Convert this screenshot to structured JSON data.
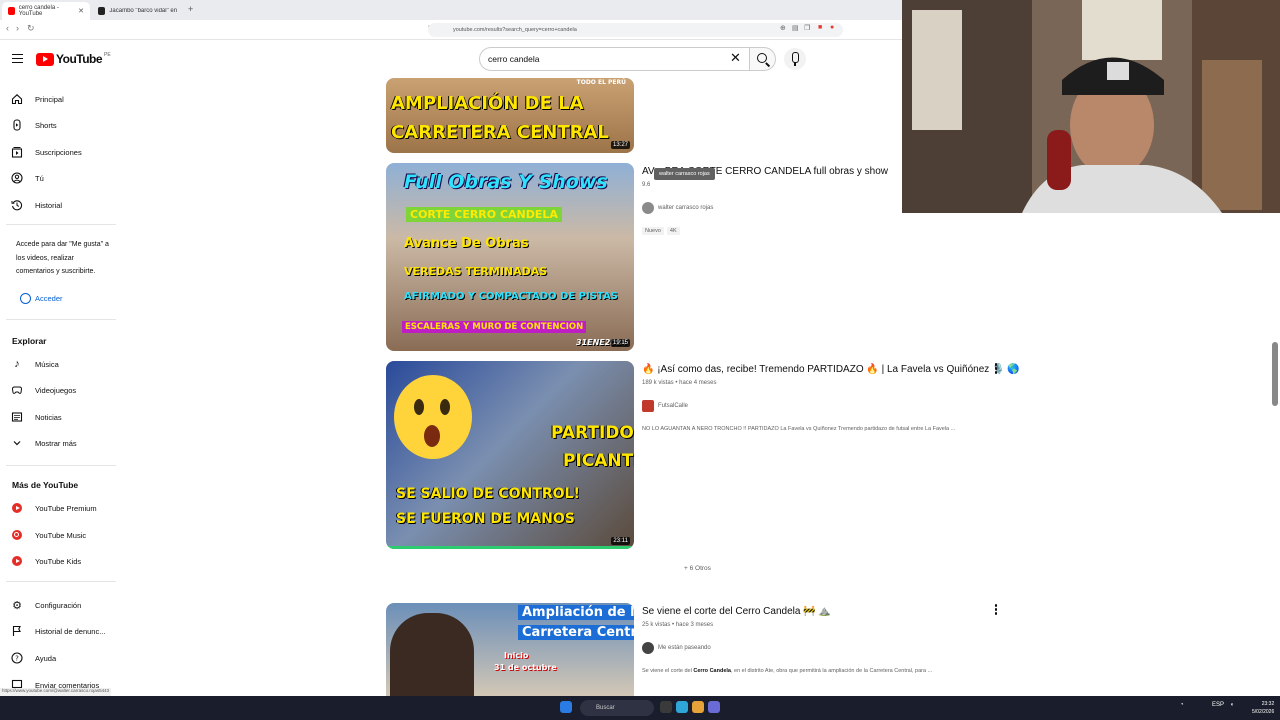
{
  "browser": {
    "tabs": [
      {
        "title": "cerro candela - YouTube",
        "active": true
      },
      {
        "title": "Jacambo \"barco vidal\" en TikTok | Se",
        "active": false
      }
    ],
    "new_tab": "+",
    "url": "youtube.com/results?search_query=cerro+candela"
  },
  "header": {
    "logo_text": "YouTube",
    "region": "PE",
    "search_value": "cerro candela"
  },
  "sidebar": {
    "main": [
      {
        "label": "Principal",
        "icon": "home-icon"
      },
      {
        "label": "Shorts",
        "icon": "shorts-icon"
      },
      {
        "label": "Suscripciones",
        "icon": "subscriptions-icon"
      },
      {
        "label": "Tú",
        "icon": "user-icon"
      },
      {
        "label": "Historial",
        "icon": "history-icon"
      }
    ],
    "signin_prompt": "Accede para dar \"Me gusta\" a los videos, realizar comentarios y suscribirte.",
    "signin_label": "Acceder",
    "explore_heading": "Explorar",
    "explore": [
      {
        "label": "Música",
        "icon": "music-icon"
      },
      {
        "label": "Videojuegos",
        "icon": "gaming-icon"
      },
      {
        "label": "Noticias",
        "icon": "news-icon"
      },
      {
        "label": "Mostrar más",
        "icon": "chevron-down-icon"
      }
    ],
    "more_heading": "Más de YouTube",
    "more": [
      {
        "label": "YouTube Premium",
        "icon": "youtube-premium-icon"
      },
      {
        "label": "YouTube Music",
        "icon": "youtube-music-icon"
      },
      {
        "label": "YouTube Kids",
        "icon": "youtube-kids-icon"
      }
    ],
    "settings": [
      {
        "label": "Configuración",
        "icon": "gear-icon"
      },
      {
        "label": "Historial de denunc...",
        "icon": "flag-icon"
      },
      {
        "label": "Ayuda",
        "icon": "help-icon"
      },
      {
        "label": "Enviar comentarios",
        "icon": "feedback-icon"
      }
    ],
    "status_url": "https://www.youtube.com/@walter.carrasco.rojas5443"
  },
  "results": [
    {
      "thumb_lines": [
        "TODO EL PERÚ",
        "AMPLIACIÓN DE LA",
        "CARRETERA CENTRAL"
      ],
      "duration": "13:27"
    },
    {
      "title": "AV... BRA CORTE CERRO CANDELA full obras y show",
      "meta": "9.6",
      "channel": "walter carrasco rojas",
      "tooltip": "walter carrasco rojas",
      "badges": [
        "Nuevo",
        "4K"
      ],
      "duration": "19:15",
      "thumb_lines": [
        "Full Obras Y Shows",
        "CORTE CERRO CANDELA",
        "Avance De Obras",
        "VEREDAS TERMINADAS",
        "AFIRMADO Y COMPACTADO DE PISTAS",
        "ESCALERAS Y MURO DE CONTENCION",
        "31ENE2024"
      ]
    },
    {
      "title": "🔥 ¡Así como das, recibe! Tremendo PARTIDAZO 🔥 | La Favela vs Quiñónez 🎙️ 🌎",
      "meta": "189 k vistas • hace 4 meses",
      "channel": "FutsalCalle",
      "description": "NO LO AGUANTAN A NERO TRONCHO !! PARTIDAZO La Favela vs Quiñonez Tremendo partidazo de futsal entre La Favela ...",
      "duration": "23:11",
      "thumb_lines": [
        "PARTIDO",
        "PICANTE",
        "SE SALIO DE CONTROL!",
        "SE FUERON DE MANOS"
      ]
    },
    {
      "more_label": "+ 6 Otros"
    },
    {
      "title": "Se viene el corte del Cerro Candela 🚧 ⛰️",
      "meta": "25 k vistas • hace 3 meses",
      "channel": "Me están paseando",
      "desc_pre": "Se viene el corte del ",
      "desc_bold": "Cerro Candela",
      "desc_post": ", en el distrito Ate, obra que permitirá la ampliación de la Carretera Central, para ...",
      "thumb_lines": [
        "Ampliación de la",
        "Carretera Central",
        "Inicio",
        "31 de octubre"
      ]
    }
  ],
  "taskbar": {
    "search_placeholder": "Buscar",
    "lang": "ESP",
    "lang2": "LAA",
    "time": "23:32",
    "date": "5/02/2026"
  },
  "colors": {
    "brand": "#ff0000",
    "link": "#065fd4"
  }
}
